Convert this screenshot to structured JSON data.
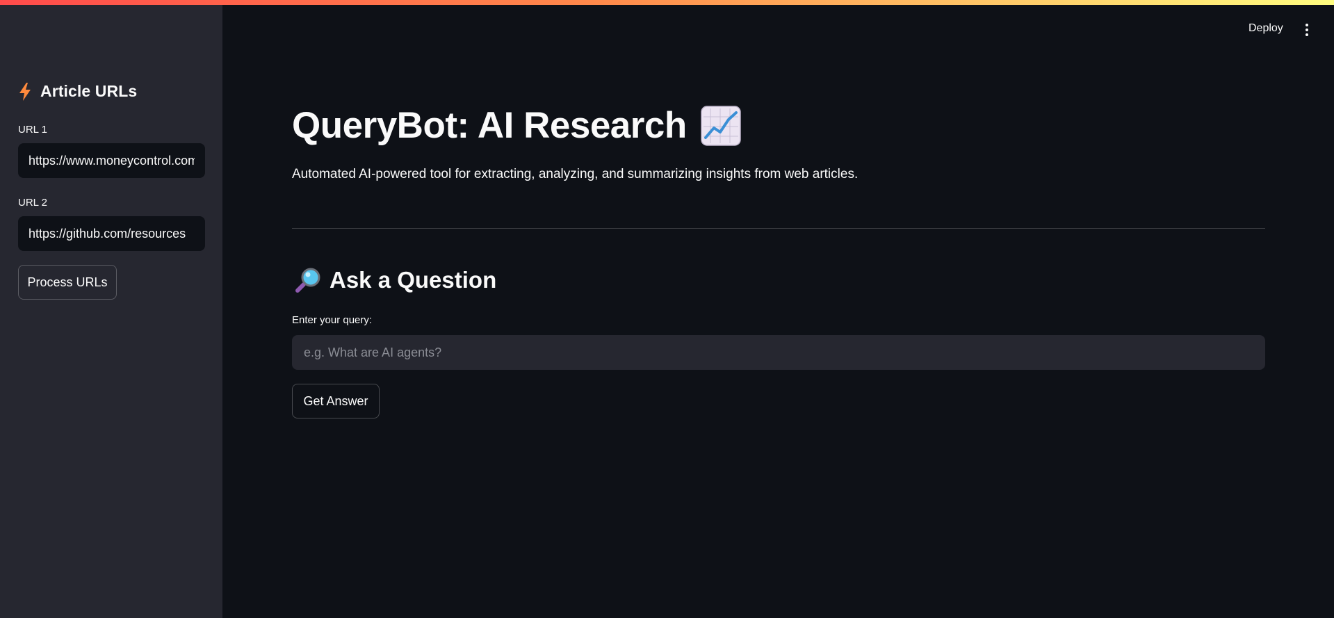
{
  "colors": {
    "background": "#0e1117",
    "sidebar": "#262730",
    "text": "#fafafa",
    "accent_gradient": [
      "#ff4b4b",
      "#ff8a4b",
      "#fffd80"
    ]
  },
  "toolbar": {
    "deploy_label": "Deploy",
    "menu_icon": "kebab-menu-icon"
  },
  "sidebar": {
    "header_icon": "lightning-bolt-icon",
    "title": "Article URLs",
    "url_fields": [
      {
        "label": "URL 1",
        "value": "https://www.moneycontrol.com"
      },
      {
        "label": "URL 2",
        "value": "https://github.com/resources"
      }
    ],
    "process_button": "Process URLs"
  },
  "main": {
    "title": "QueryBot: AI Research",
    "title_icon": "chart-increasing-icon",
    "description": "Automated AI-powered tool for extracting, analyzing, and summarizing insights from web articles.",
    "section_icon": "magnifying-glass-icon",
    "section_title": "Ask a Question",
    "query_label": "Enter your query:",
    "query_value": "",
    "query_placeholder": "e.g. What are AI agents?",
    "answer_button": "Get Answer"
  }
}
